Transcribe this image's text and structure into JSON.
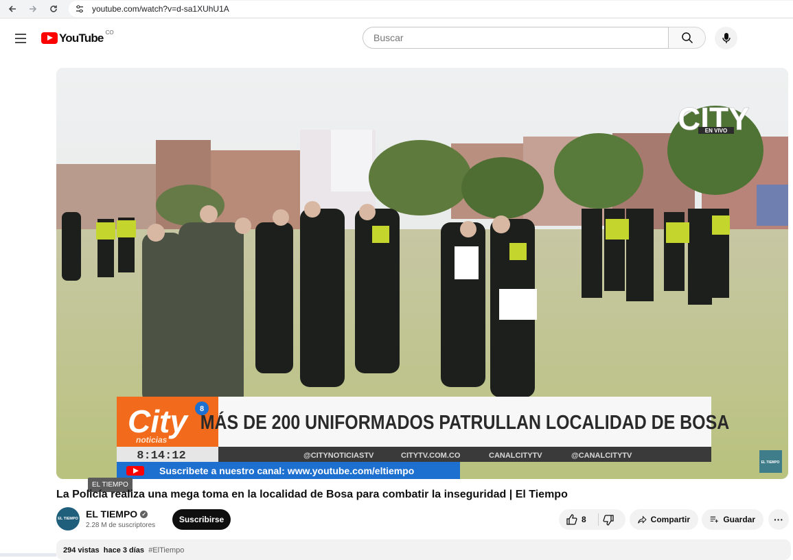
{
  "browser": {
    "url": "youtube.com/watch?v=d-sa1XUhU1A",
    "icons": [
      "back-arrow-icon",
      "forward-arrow-icon",
      "reload-icon",
      "site-settings-icon"
    ]
  },
  "header": {
    "logo_text": "YouTube",
    "country_code": "CO",
    "search_placeholder": "Buscar",
    "icons": [
      "hamburger-menu-icon",
      "search-icon",
      "microphone-icon"
    ]
  },
  "video": {
    "overlay_channel_label": "EL TIEMPO",
    "overlay": {
      "corner_logo": "CITY",
      "live_label": "EN VIVO",
      "brand_main": "City",
      "brand_sub": "noticias",
      "channel_number": "8",
      "headline": "MÁS DE 200 UNIFORMADOS PATRULLAN LOCALIDAD DE BOSA",
      "clock": "8:14:12",
      "socials": [
        "@CITYNOTICIASTV",
        "CITYTV.COM.CO",
        "CANALCITYTV",
        "@CANALCITYTV"
      ],
      "subscribe_banner": "Suscribete a nuestro canal: www.youtube.com/eltiempo",
      "corner_badge": "EL TIEMPO"
    }
  },
  "meta": {
    "title": "La Policía realiza una mega toma en la localidad de Bosa para combatir la inseguridad | El Tiempo",
    "channel_name": "EL TIEMPO",
    "avatar_text": "EL TIEMPO",
    "subscribers": "2.28 M de suscriptores",
    "subscribe_label": "Suscribirse",
    "likes": "8",
    "share_label": "Compartir",
    "save_label": "Guardar",
    "views": "294 vistas",
    "age": "hace 3 días",
    "hashtag": "#ElTiempo"
  },
  "colors": {
    "yt_red": "#ff0000",
    "city_orange": "#f26a1b",
    "city_blue": "#1d6fd0",
    "banner_dark": "#3a3a3a"
  }
}
